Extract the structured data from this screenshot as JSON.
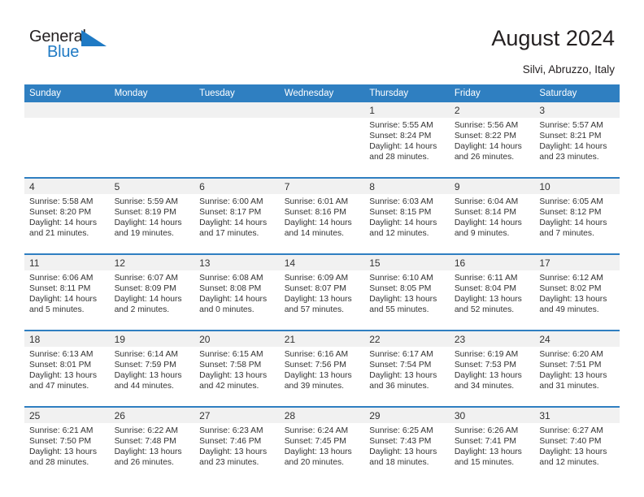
{
  "brand": {
    "name_part1": "General",
    "name_part2": "Blue",
    "logo_icon": "triangle-flag-icon",
    "color_primary": "#1f7ac4",
    "color_text": "#231f20"
  },
  "header": {
    "title": "August 2024",
    "subtitle": "Silvi, Abruzzo, Italy"
  },
  "calendar": {
    "header_bg": "#2f7fc1",
    "daynum_bg": "#f1f1f1",
    "weekdays": [
      "Sunday",
      "Monday",
      "Tuesday",
      "Wednesday",
      "Thursday",
      "Friday",
      "Saturday"
    ],
    "weeks": [
      [
        {
          "day": "",
          "sunrise": "",
          "sunset": "",
          "daylight1": "",
          "daylight2": ""
        },
        {
          "day": "",
          "sunrise": "",
          "sunset": "",
          "daylight1": "",
          "daylight2": ""
        },
        {
          "day": "",
          "sunrise": "",
          "sunset": "",
          "daylight1": "",
          "daylight2": ""
        },
        {
          "day": "",
          "sunrise": "",
          "sunset": "",
          "daylight1": "",
          "daylight2": ""
        },
        {
          "day": "1",
          "sunrise": "Sunrise: 5:55 AM",
          "sunset": "Sunset: 8:24 PM",
          "daylight1": "Daylight: 14 hours",
          "daylight2": "and 28 minutes."
        },
        {
          "day": "2",
          "sunrise": "Sunrise: 5:56 AM",
          "sunset": "Sunset: 8:22 PM",
          "daylight1": "Daylight: 14 hours",
          "daylight2": "and 26 minutes."
        },
        {
          "day": "3",
          "sunrise": "Sunrise: 5:57 AM",
          "sunset": "Sunset: 8:21 PM",
          "daylight1": "Daylight: 14 hours",
          "daylight2": "and 23 minutes."
        }
      ],
      [
        {
          "day": "4",
          "sunrise": "Sunrise: 5:58 AM",
          "sunset": "Sunset: 8:20 PM",
          "daylight1": "Daylight: 14 hours",
          "daylight2": "and 21 minutes."
        },
        {
          "day": "5",
          "sunrise": "Sunrise: 5:59 AM",
          "sunset": "Sunset: 8:19 PM",
          "daylight1": "Daylight: 14 hours",
          "daylight2": "and 19 minutes."
        },
        {
          "day": "6",
          "sunrise": "Sunrise: 6:00 AM",
          "sunset": "Sunset: 8:17 PM",
          "daylight1": "Daylight: 14 hours",
          "daylight2": "and 17 minutes."
        },
        {
          "day": "7",
          "sunrise": "Sunrise: 6:01 AM",
          "sunset": "Sunset: 8:16 PM",
          "daylight1": "Daylight: 14 hours",
          "daylight2": "and 14 minutes."
        },
        {
          "day": "8",
          "sunrise": "Sunrise: 6:03 AM",
          "sunset": "Sunset: 8:15 PM",
          "daylight1": "Daylight: 14 hours",
          "daylight2": "and 12 minutes."
        },
        {
          "day": "9",
          "sunrise": "Sunrise: 6:04 AM",
          "sunset": "Sunset: 8:14 PM",
          "daylight1": "Daylight: 14 hours",
          "daylight2": "and 9 minutes."
        },
        {
          "day": "10",
          "sunrise": "Sunrise: 6:05 AM",
          "sunset": "Sunset: 8:12 PM",
          "daylight1": "Daylight: 14 hours",
          "daylight2": "and 7 minutes."
        }
      ],
      [
        {
          "day": "11",
          "sunrise": "Sunrise: 6:06 AM",
          "sunset": "Sunset: 8:11 PM",
          "daylight1": "Daylight: 14 hours",
          "daylight2": "and 5 minutes."
        },
        {
          "day": "12",
          "sunrise": "Sunrise: 6:07 AM",
          "sunset": "Sunset: 8:09 PM",
          "daylight1": "Daylight: 14 hours",
          "daylight2": "and 2 minutes."
        },
        {
          "day": "13",
          "sunrise": "Sunrise: 6:08 AM",
          "sunset": "Sunset: 8:08 PM",
          "daylight1": "Daylight: 14 hours",
          "daylight2": "and 0 minutes."
        },
        {
          "day": "14",
          "sunrise": "Sunrise: 6:09 AM",
          "sunset": "Sunset: 8:07 PM",
          "daylight1": "Daylight: 13 hours",
          "daylight2": "and 57 minutes."
        },
        {
          "day": "15",
          "sunrise": "Sunrise: 6:10 AM",
          "sunset": "Sunset: 8:05 PM",
          "daylight1": "Daylight: 13 hours",
          "daylight2": "and 55 minutes."
        },
        {
          "day": "16",
          "sunrise": "Sunrise: 6:11 AM",
          "sunset": "Sunset: 8:04 PM",
          "daylight1": "Daylight: 13 hours",
          "daylight2": "and 52 minutes."
        },
        {
          "day": "17",
          "sunrise": "Sunrise: 6:12 AM",
          "sunset": "Sunset: 8:02 PM",
          "daylight1": "Daylight: 13 hours",
          "daylight2": "and 49 minutes."
        }
      ],
      [
        {
          "day": "18",
          "sunrise": "Sunrise: 6:13 AM",
          "sunset": "Sunset: 8:01 PM",
          "daylight1": "Daylight: 13 hours",
          "daylight2": "and 47 minutes."
        },
        {
          "day": "19",
          "sunrise": "Sunrise: 6:14 AM",
          "sunset": "Sunset: 7:59 PM",
          "daylight1": "Daylight: 13 hours",
          "daylight2": "and 44 minutes."
        },
        {
          "day": "20",
          "sunrise": "Sunrise: 6:15 AM",
          "sunset": "Sunset: 7:58 PM",
          "daylight1": "Daylight: 13 hours",
          "daylight2": "and 42 minutes."
        },
        {
          "day": "21",
          "sunrise": "Sunrise: 6:16 AM",
          "sunset": "Sunset: 7:56 PM",
          "daylight1": "Daylight: 13 hours",
          "daylight2": "and 39 minutes."
        },
        {
          "day": "22",
          "sunrise": "Sunrise: 6:17 AM",
          "sunset": "Sunset: 7:54 PM",
          "daylight1": "Daylight: 13 hours",
          "daylight2": "and 36 minutes."
        },
        {
          "day": "23",
          "sunrise": "Sunrise: 6:19 AM",
          "sunset": "Sunset: 7:53 PM",
          "daylight1": "Daylight: 13 hours",
          "daylight2": "and 34 minutes."
        },
        {
          "day": "24",
          "sunrise": "Sunrise: 6:20 AM",
          "sunset": "Sunset: 7:51 PM",
          "daylight1": "Daylight: 13 hours",
          "daylight2": "and 31 minutes."
        }
      ],
      [
        {
          "day": "25",
          "sunrise": "Sunrise: 6:21 AM",
          "sunset": "Sunset: 7:50 PM",
          "daylight1": "Daylight: 13 hours",
          "daylight2": "and 28 minutes."
        },
        {
          "day": "26",
          "sunrise": "Sunrise: 6:22 AM",
          "sunset": "Sunset: 7:48 PM",
          "daylight1": "Daylight: 13 hours",
          "daylight2": "and 26 minutes."
        },
        {
          "day": "27",
          "sunrise": "Sunrise: 6:23 AM",
          "sunset": "Sunset: 7:46 PM",
          "daylight1": "Daylight: 13 hours",
          "daylight2": "and 23 minutes."
        },
        {
          "day": "28",
          "sunrise": "Sunrise: 6:24 AM",
          "sunset": "Sunset: 7:45 PM",
          "daylight1": "Daylight: 13 hours",
          "daylight2": "and 20 minutes."
        },
        {
          "day": "29",
          "sunrise": "Sunrise: 6:25 AM",
          "sunset": "Sunset: 7:43 PM",
          "daylight1": "Daylight: 13 hours",
          "daylight2": "and 18 minutes."
        },
        {
          "day": "30",
          "sunrise": "Sunrise: 6:26 AM",
          "sunset": "Sunset: 7:41 PM",
          "daylight1": "Daylight: 13 hours",
          "daylight2": "and 15 minutes."
        },
        {
          "day": "31",
          "sunrise": "Sunrise: 6:27 AM",
          "sunset": "Sunset: 7:40 PM",
          "daylight1": "Daylight: 13 hours",
          "daylight2": "and 12 minutes."
        }
      ]
    ]
  }
}
